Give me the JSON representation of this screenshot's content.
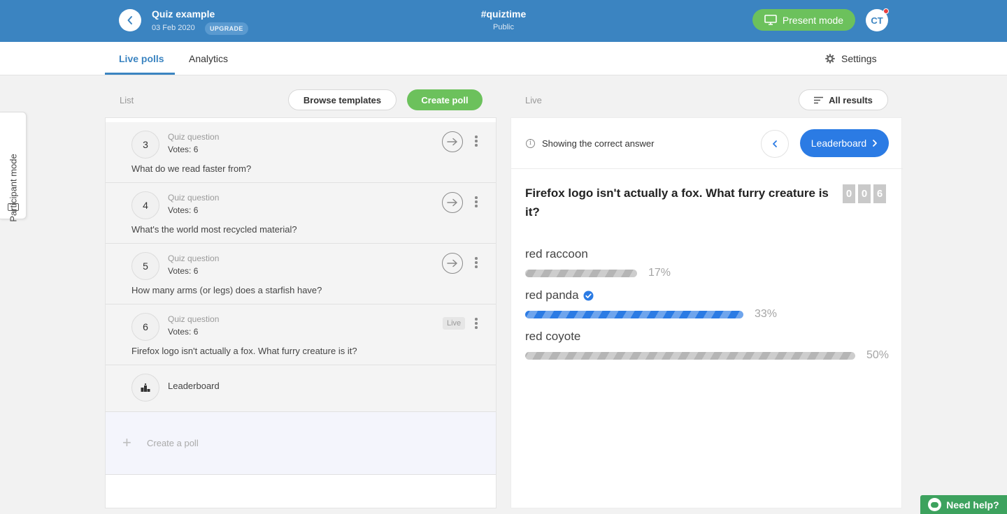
{
  "header": {
    "title": "Quiz example",
    "date": "03 Feb 2020",
    "upgrade_label": "UPGRADE",
    "event_code": "#quiztime",
    "visibility": "Public",
    "present_label": "Present mode",
    "avatar_initials": "CT"
  },
  "tabs": [
    {
      "label": "Live polls",
      "active": true
    },
    {
      "label": "Analytics",
      "active": false
    }
  ],
  "settings_label": "Settings",
  "participant_mode_label": "Participant mode",
  "list": {
    "section_label": "List",
    "browse_label": "Browse templates",
    "create_label": "Create poll",
    "polls": [
      {
        "number": "3",
        "type": "Quiz question",
        "votes": "Votes: 6",
        "question": "What do we read faster from?",
        "live": false
      },
      {
        "number": "4",
        "type": "Quiz question",
        "votes": "Votes: 6",
        "question": "What's the world most recycled material?",
        "live": false
      },
      {
        "number": "5",
        "type": "Quiz question",
        "votes": "Votes: 6",
        "question": "How many arms (or legs) does a starfish have?",
        "live": false
      },
      {
        "number": "6",
        "type": "Quiz question",
        "votes": "Votes: 6",
        "question": "Firefox logo isn't actually a fox. What furry creature is it?",
        "live": true,
        "live_label": "Live"
      }
    ],
    "leaderboard_label": "Leaderboard",
    "create_row_label": "Create a poll"
  },
  "live": {
    "section_label": "Live",
    "all_results_label": "All results",
    "correct_answer_label": "Showing the correct answer",
    "leaderboard_button_label": "Leaderboard",
    "question": "Firefox logo isn't actually a fox. What furry creature is it?",
    "counter_digits": [
      "0",
      "0",
      "6"
    ],
    "options": [
      {
        "label": "red raccoon",
        "percent": "17%",
        "share": 0.17,
        "correct": false
      },
      {
        "label": "red panda",
        "percent": "33%",
        "share": 0.33,
        "correct": true
      },
      {
        "label": "red coyote",
        "percent": "50%",
        "share": 0.5,
        "correct": false
      }
    ]
  },
  "help_label": "Need help?",
  "colors": {
    "brand_blue": "#3b84c1",
    "accent_green": "#6cc15c",
    "button_blue": "#2b7be4",
    "help_green": "#3da25e"
  }
}
